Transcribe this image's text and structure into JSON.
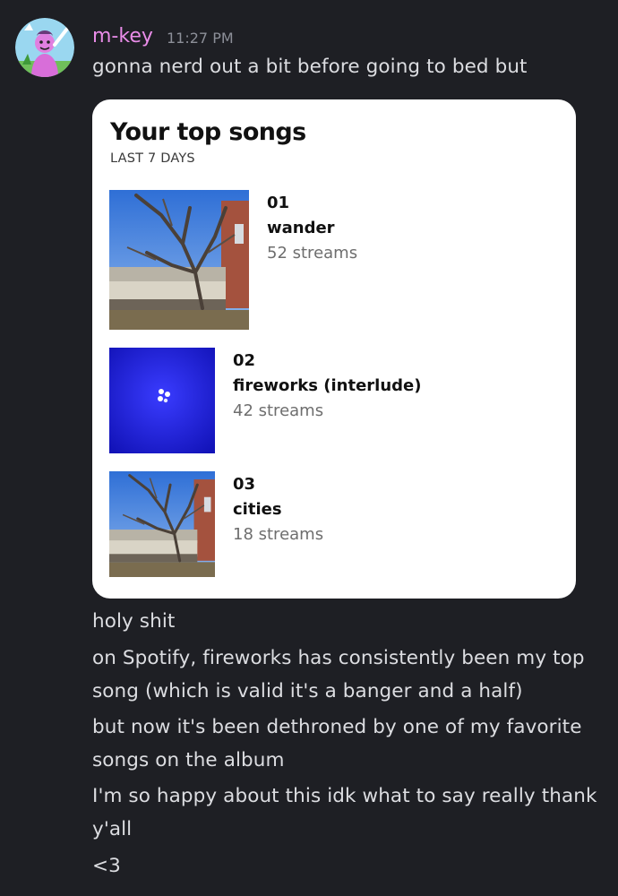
{
  "message": {
    "username": "m-key",
    "timestamp": "11:27 PM",
    "avatar_icon": "avatar-icon",
    "first_line": "gonna nerd out a bit before going to bed but",
    "followups": [
      "holy shit",
      "on Spotify, fireworks has consistently been my top song (which is valid it's a banger and a half)",
      "but now it's been dethroned by one of my favorite songs on the album",
      "I'm so happy about this idk what to say really thank y'all",
      "<3"
    ]
  },
  "card": {
    "title": "Your top songs",
    "subtitle": "LAST 7 DAYS",
    "songs": [
      {
        "rank": "01",
        "title": "wander",
        "streams": "52 streams"
      },
      {
        "rank": "02",
        "title": "fireworks (interlude)",
        "streams": "42 streams"
      },
      {
        "rank": "03",
        "title": "cities",
        "streams": "18 streams"
      }
    ]
  },
  "colors": {
    "background": "#1e1f24",
    "username": "#e98ce8",
    "text": "#dcdde1",
    "card": "#ffffff",
    "fireworks_art": "#1d1fd6"
  }
}
